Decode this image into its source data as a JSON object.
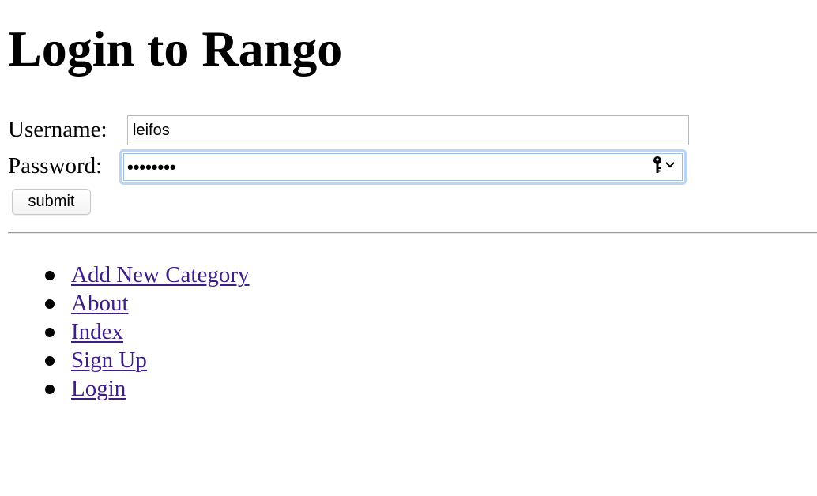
{
  "page": {
    "title": "Login to Rango"
  },
  "form": {
    "username_label": "Username:",
    "username_value": "leifos",
    "password_label": "Password:",
    "password_masked": "••••••••",
    "submit_label": "submit"
  },
  "icons": {
    "password_key": "key-icon",
    "password_menu": "chevron-down-icon"
  },
  "colors": {
    "link": "#3e1d86",
    "focus_ring": "#b6d6f7"
  },
  "nav": {
    "items": [
      {
        "label": "Add New Category"
      },
      {
        "label": "About"
      },
      {
        "label": "Index"
      },
      {
        "label": "Sign Up"
      },
      {
        "label": "Login"
      }
    ]
  }
}
